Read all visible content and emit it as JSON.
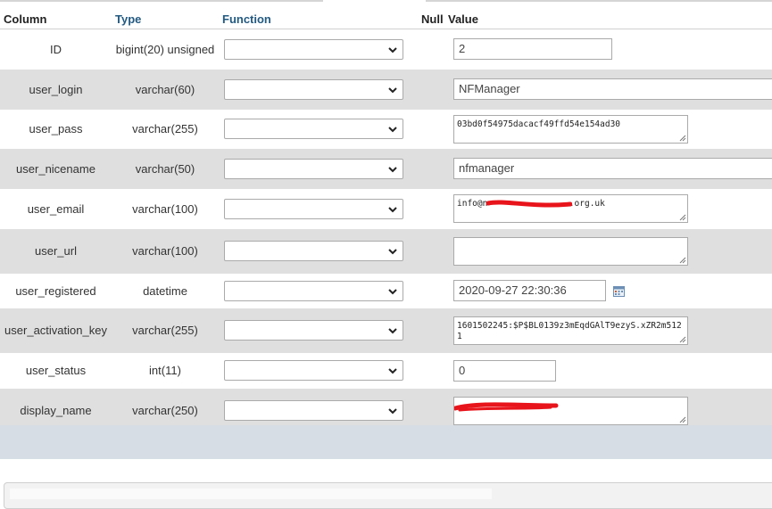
{
  "columns_header": {
    "column": "Column",
    "type": "Type",
    "function": "Function",
    "null": "Null",
    "value": "Value"
  },
  "rows": [
    {
      "name": "ID",
      "type": "bigint(20) unsigned",
      "function": "",
      "value": "2"
    },
    {
      "name": "user_login",
      "type": "varchar(60)",
      "function": "",
      "value": "NFManager"
    },
    {
      "name": "user_pass",
      "type": "varchar(255)",
      "function": "",
      "value": "03bd0f54975dacacf49ffd54e154ad30"
    },
    {
      "name": "user_nicename",
      "type": "varchar(50)",
      "function": "",
      "value": "nfmanager"
    },
    {
      "name": "user_email",
      "type": "varchar(100)",
      "function": "",
      "value": "info@n                .org.uk"
    },
    {
      "name": "user_url",
      "type": "varchar(100)",
      "function": "",
      "value": ""
    },
    {
      "name": "user_registered",
      "type": "datetime",
      "function": "",
      "value": "2020-09-27 22:30:36"
    },
    {
      "name": "user_activation_key",
      "type": "varchar(255)",
      "function": "",
      "value": "1601502245:$P$BL0139z3mEqdGAlT9ezyS.xZR2m5121"
    },
    {
      "name": "user_status",
      "type": "int(11)",
      "function": "",
      "value": "0"
    },
    {
      "name": "display_name",
      "type": "varchar(250)",
      "function": "",
      "value": ""
    }
  ],
  "icons": {
    "dropdown": "chevron-down-icon",
    "calendar": "calendar-icon",
    "resize": "resize-grip-icon"
  },
  "colors": {
    "header_link": "#235a81",
    "row_alt": "#dfdfdf",
    "footer_band": "#d6dde5",
    "redaction": "#e8141b"
  }
}
